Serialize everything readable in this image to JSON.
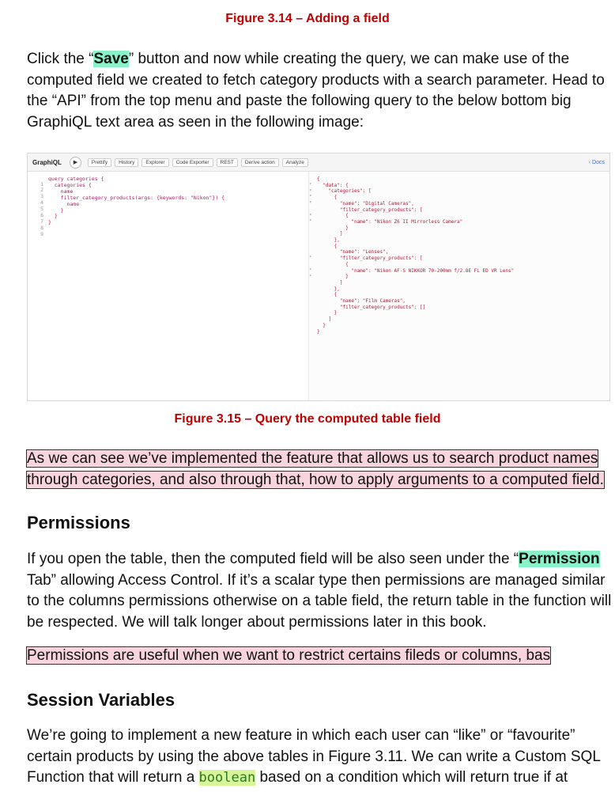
{
  "figure_314_caption": "Figure 3.14 – Adding a field",
  "para1": {
    "before": "Click the “",
    "save_word": "Save",
    "after": "” button and now while creating the query, we can make use of the computed field we created to fetch category products with a search parameter. Head to the “API” from the top menu and paste the following query to the below bottom big GraphiQL text area as seen in the following image:"
  },
  "graphiql": {
    "title": "GraphiQL",
    "play_icon": "play-icon",
    "buttons": [
      "Prettify",
      "History",
      "Explorer",
      "Code Exporter",
      "REST",
      "Derive action",
      "Analyze"
    ],
    "docs_label": "‹ Docs",
    "line_numbers": "1\n2\n3\n4\n5\n6\n7\n8\n9",
    "query_text": "query categories {\n  categories {\n    name\n    filter_category_products(args: {keywords: \"Nikon\"}) {\n      name\n    }\n  }\n}",
    "result_text": "{\n  \"data\": {\n    \"categories\": [\n      {\n        \"name\": \"Digital Cameras\",\n        \"filter_category_products\": [\n          {\n            \"name\": \"Nikon Z6 II Mirrorless Camera\"\n          }\n        ]\n      },\n      {\n        \"name\": \"Lenses\",\n        \"filter_category_products\": [\n          {\n            \"name\": \"Nikon AF-S NIKKOR 70-200mm f/2.8E FL ED VR Lens\"\n          }\n        ]\n      },\n      {\n        \"name\": \"Film Cameras\",\n        \"filter_category_products\": []\n      }\n    ]\n  }\n}",
    "result_gutter": "▾\n▾\n▾\n▾\n\n▾\n▾\n\n\n\n\n\n▾\n\n▾\n▾"
  },
  "figure_315_caption": "Figure 3.15 – Query the computed table field",
  "para2": "As we can see we’ve implemented the feature that allows us to search product names through categories, and also through that, how to apply arguments to a computed field.",
  "heading_permissions": "Permissions",
  "para3": {
    "before": "If you open the table, then the computed field will be also seen under the “",
    "permission_word": "Permission",
    "after": " Tab” allowing Access Control. If it’s a scalar type then permissions are managed similar to the columns permissions otherwise on a table field, the return table in the function will be respected. We will talk longer about permissions later in this book."
  },
  "para4": "Permissions are useful when we want to restrict certains fileds or columns, bas",
  "heading_session": "Session Variables",
  "para5": {
    "before": "We’re going to implement a new feature in which each user can “like” or “favourite” certain products by using the above tables in Figure 3.11. We can write a Custom SQL Function that will return a ",
    "code_word": "boolean",
    "after": " based on a condition which will return true if at"
  }
}
